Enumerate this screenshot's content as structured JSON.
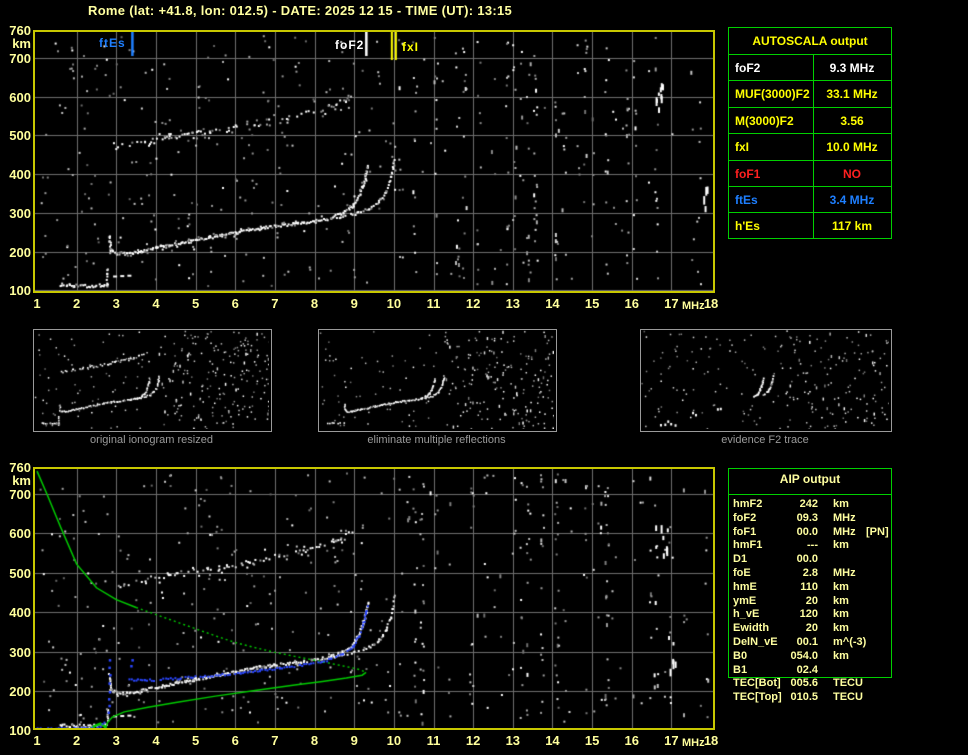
{
  "title": "Rome (lat: +41.8, lon: 012.5) - DATE: 2025 12 15 - TIME (UT): 13:15",
  "colors": {
    "pale_yellow": "#ffffa0",
    "tick_yellow": "#ffff9c",
    "bright_yellow": "#ffff00",
    "plot_border": "#c8c800",
    "grid": "#6f6f6f",
    "table_green": "#00d000",
    "profile_green": "#00cc00",
    "trace_blue": "#2a46ff",
    "marker_blue": "#1e7fff",
    "white": "#ffffff",
    "red": "#ff2020",
    "caption_gray": "#9a9a9a"
  },
  "axes": {
    "x_ticks": [
      "1",
      "2",
      "3",
      "4",
      "5",
      "6",
      "7",
      "8",
      "9",
      "10",
      "11",
      "12",
      "13",
      "14",
      "15",
      "16",
      "17",
      "18"
    ],
    "x_unit": "MHz",
    "y_ticks": [
      "700",
      "600",
      "500",
      "400",
      "300",
      "200",
      "100"
    ],
    "y_top_label": "760",
    "y_unit": "km",
    "x_range_mhz": [
      1,
      18
    ],
    "y_range_km": [
      80,
      760
    ]
  },
  "top_plot": {
    "markers": [
      {
        "label": "ftEs",
        "freq_mhz": 3.4,
        "color": "#1e7fff",
        "style": "single"
      },
      {
        "label": "foF2",
        "freq_mhz": 9.3,
        "color": "#ffffff",
        "style": "single"
      },
      {
        "label": "fxI",
        "freq_mhz": 10.0,
        "color": "#ffff00",
        "style": "double"
      }
    ]
  },
  "ionogram_traces": {
    "e": [
      [
        1.55,
        117
      ],
      [
        1.9,
        114
      ],
      [
        2.3,
        113
      ],
      [
        2.6,
        115
      ],
      [
        2.72,
        117
      ]
    ],
    "e_spike": [
      [
        2.75,
        100
      ],
      [
        2.75,
        158
      ]
    ],
    "es_dashes": [
      [
        2.92,
        138
      ],
      [
        3.1,
        139
      ],
      [
        3.28,
        140
      ]
    ],
    "f_o": [
      [
        2.8,
        243
      ],
      [
        2.84,
        206
      ],
      [
        3.0,
        197
      ],
      [
        3.25,
        196
      ],
      [
        3.6,
        203
      ],
      [
        4.0,
        212
      ],
      [
        4.5,
        222
      ],
      [
        5.0,
        232
      ],
      [
        5.5,
        241
      ],
      [
        6.0,
        251
      ],
      [
        6.5,
        261
      ],
      [
        7.0,
        268
      ],
      [
        7.5,
        274
      ],
      [
        8.0,
        281
      ],
      [
        8.4,
        290
      ],
      [
        8.7,
        302
      ],
      [
        8.95,
        320
      ],
      [
        9.1,
        345
      ],
      [
        9.2,
        372
      ],
      [
        9.28,
        400
      ],
      [
        9.32,
        425
      ]
    ],
    "f_x": [
      [
        8.3,
        286
      ],
      [
        8.7,
        293
      ],
      [
        9.05,
        301
      ],
      [
        9.35,
        313
      ],
      [
        9.6,
        331
      ],
      [
        9.78,
        356
      ],
      [
        9.9,
        388
      ],
      [
        9.96,
        418
      ],
      [
        9.99,
        442
      ]
    ],
    "f2hop": [
      [
        2.9,
        468
      ],
      [
        3.3,
        476
      ],
      [
        3.8,
        486
      ],
      [
        4.3,
        496
      ],
      [
        4.8,
        504
      ],
      [
        5.3,
        511
      ],
      [
        5.8,
        519
      ],
      [
        6.3,
        528
      ],
      [
        6.8,
        538
      ],
      [
        7.3,
        549
      ],
      [
        7.8,
        560
      ],
      [
        8.2,
        572
      ],
      [
        8.5,
        583
      ],
      [
        8.75,
        595
      ],
      [
        8.9,
        604
      ]
    ]
  },
  "bottom_overlays": {
    "green_upper_solid": [
      [
        1.0,
        758
      ],
      [
        1.25,
        700
      ],
      [
        1.6,
        615
      ],
      [
        2.0,
        522
      ],
      [
        2.5,
        462
      ],
      [
        3.0,
        432
      ],
      [
        3.5,
        412
      ]
    ],
    "green_upper_dotted": [
      [
        3.5,
        412
      ],
      [
        4.0,
        394
      ],
      [
        4.5,
        376
      ],
      [
        5.0,
        358
      ],
      [
        5.5,
        340
      ],
      [
        6.0,
        323
      ],
      [
        6.5,
        310
      ],
      [
        7.0,
        298
      ],
      [
        7.5,
        288
      ],
      [
        8.0,
        278
      ],
      [
        8.5,
        268
      ],
      [
        8.9,
        260
      ],
      [
        9.15,
        254
      ],
      [
        9.3,
        247
      ]
    ],
    "green_lower_solid": [
      [
        9.3,
        247
      ],
      [
        9.2,
        240
      ],
      [
        8.8,
        233
      ],
      [
        8.2,
        224
      ],
      [
        7.5,
        215
      ],
      [
        6.5,
        201
      ],
      [
        5.5,
        187
      ],
      [
        4.5,
        171
      ],
      [
        3.8,
        159
      ],
      [
        3.2,
        147
      ],
      [
        2.9,
        134
      ],
      [
        2.78,
        120
      ],
      [
        2.72,
        104
      ]
    ],
    "green_e_layer": [
      [
        2.3,
        100
      ],
      [
        2.45,
        111
      ],
      [
        2.6,
        117
      ],
      [
        2.7,
        111
      ],
      [
        2.76,
        101
      ]
    ],
    "blue_e": [
      [
        1.0,
        107
      ],
      [
        2.5,
        107
      ]
    ],
    "blue_e_rise": [
      [
        2.52,
        109
      ],
      [
        2.68,
        124
      ]
    ],
    "blue_spike_dots": [
      [
        2.78,
        148
      ],
      [
        2.8,
        165
      ],
      [
        2.79,
        182
      ],
      [
        2.81,
        200
      ],
      [
        2.8,
        222
      ],
      [
        2.82,
        243
      ],
      [
        2.8,
        262
      ],
      [
        2.81,
        281
      ]
    ],
    "blue_extra_dots": [
      [
        3.35,
        266
      ],
      [
        3.38,
        281
      ]
    ],
    "blue_f": [
      [
        3.3,
        231
      ],
      [
        3.7,
        229
      ],
      [
        4.1,
        231
      ],
      [
        4.6,
        235
      ],
      [
        5.1,
        239
      ],
      [
        5.6,
        243
      ],
      [
        6.1,
        248
      ],
      [
        6.6,
        254
      ],
      [
        7.1,
        260
      ],
      [
        7.6,
        267
      ],
      [
        8.0,
        273
      ],
      [
        8.4,
        283
      ],
      [
        8.7,
        297
      ],
      [
        8.95,
        316
      ],
      [
        9.1,
        341
      ],
      [
        9.2,
        369
      ],
      [
        9.27,
        397
      ],
      [
        9.31,
        419
      ]
    ]
  },
  "panels": {
    "captions": [
      "original ionogram resized",
      "eliminate multiple reflections",
      "evidence F2 trace"
    ]
  },
  "autoscala": {
    "title": "AUTOSCALA output",
    "rows": [
      {
        "label": "foF2",
        "value": "9.3 MHz",
        "color": "#ffffff"
      },
      {
        "label": "MUF(3000)F2",
        "value": "33.1 MHz",
        "color": "#ffff00"
      },
      {
        "label": "M(3000)F2",
        "value": "3.56",
        "color": "#ffff00"
      },
      {
        "label": "fxI",
        "value": "10.0 MHz",
        "color": "#ffff00"
      },
      {
        "label": "foF1",
        "value": "NO",
        "color": "#ff2020"
      },
      {
        "label": "ftEs",
        "value": "3.4 MHz",
        "color": "#1e7fff"
      },
      {
        "label": "h'Es",
        "value": "117   km",
        "color": "#ffff00"
      }
    ]
  },
  "aip": {
    "title": "AIP output",
    "rows": [
      {
        "l": "hmF2",
        "v": "242",
        "u": "km",
        "e": ""
      },
      {
        "l": "foF2",
        "v": "09.3",
        "u": "MHz",
        "e": ""
      },
      {
        "l": "foF1",
        "v": "00.0",
        "u": "MHz",
        "e": "[PN]"
      },
      {
        "l": "hmF1",
        "v": "---",
        "u": "km",
        "e": ""
      },
      {
        "l": "D1",
        "v": "00.0",
        "u": "",
        "e": ""
      },
      {
        "l": "foE",
        "v": "2.8",
        "u": "MHz",
        "e": ""
      },
      {
        "l": "hmE",
        "v": "110",
        "u": "km",
        "e": ""
      },
      {
        "l": "ymE",
        "v": "20",
        "u": "km",
        "e": ""
      },
      {
        "l": "h_vE",
        "v": "120",
        "u": "km",
        "e": ""
      },
      {
        "l": "Ewidth",
        "v": "20",
        "u": "km",
        "e": ""
      },
      {
        "l": "DelN_vE",
        "v": "00.1",
        "u": "m^(-3)",
        "e": ""
      },
      {
        "l": "B0",
        "v": "054.0",
        "u": "km",
        "e": ""
      },
      {
        "l": "B1",
        "v": "02.4",
        "u": "",
        "e": ""
      },
      {
        "l": "TEC[Bot]",
        "v": "005.6",
        "u": "TECU",
        "e": ""
      },
      {
        "l": "TEC[Top]",
        "v": "010.5",
        "u": "TECU",
        "e": ""
      }
    ]
  }
}
